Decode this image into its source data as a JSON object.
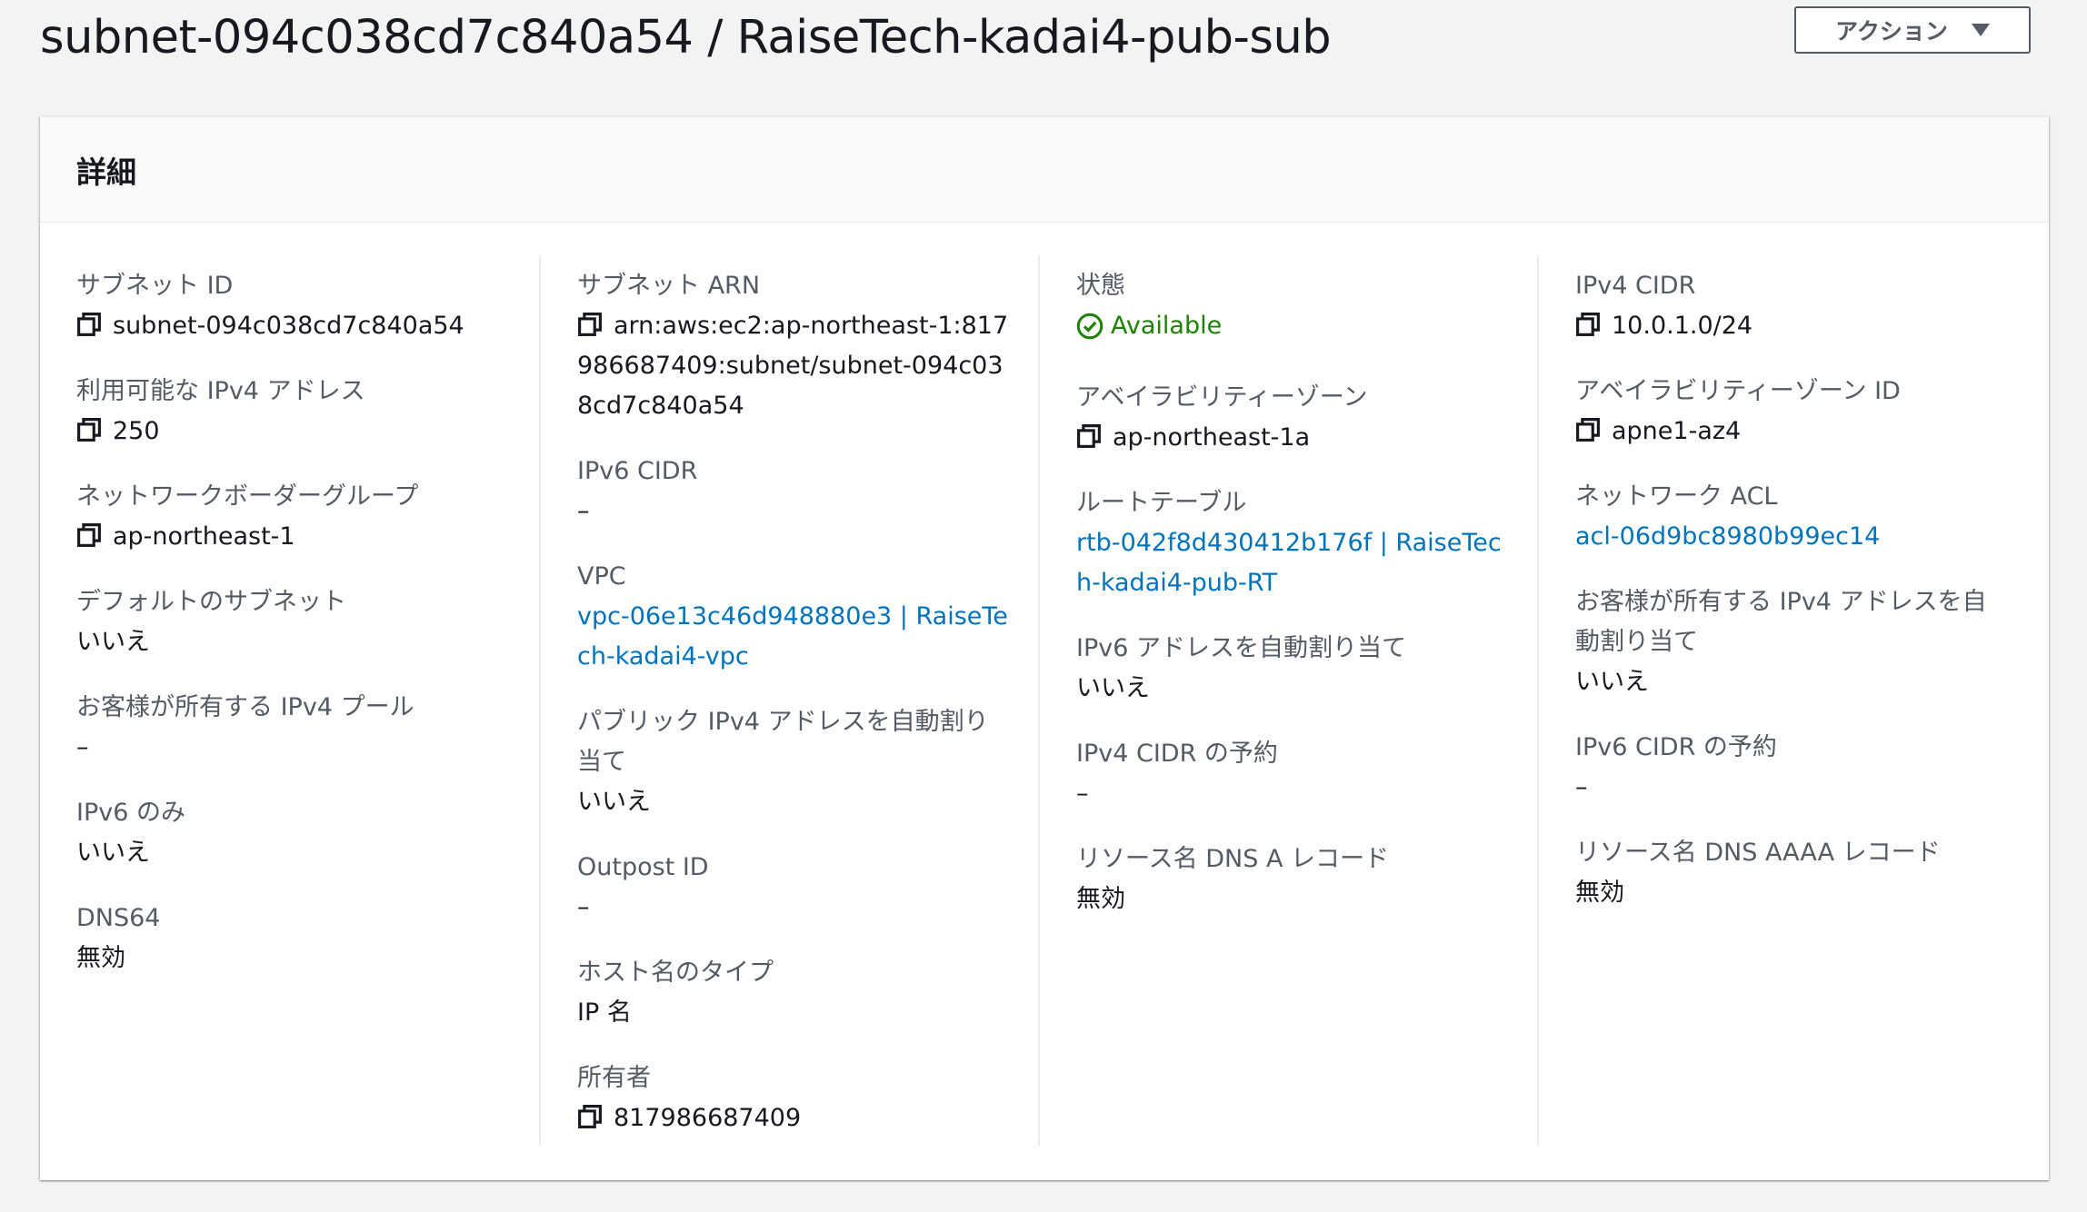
{
  "header": {
    "title": "subnet-094c038cd7c840a54 / RaiseTech-kadai4-pub-sub",
    "actions_label": "アクション"
  },
  "panel": {
    "title": "詳細"
  },
  "columns": [
    [
      {
        "label": "サブネット ID",
        "value": "subnet-094c038cd7c840a54",
        "copy": true
      },
      {
        "label": "利用可能な IPv4 アドレス",
        "value": "250",
        "copy": true
      },
      {
        "label": "ネットワークボーダーグループ",
        "value": "ap-northeast-1",
        "copy": true
      },
      {
        "label": "デフォルトのサブネット",
        "value": "いいえ"
      },
      {
        "label": "お客様が所有する IPv4 プール",
        "value": "–"
      },
      {
        "label": "IPv6 のみ",
        "value": "いいえ"
      },
      {
        "label": "DNS64",
        "value": "無効"
      }
    ],
    [
      {
        "label": "サブネット ARN",
        "value": "arn:aws:ec2:ap-northeast-1:817986687409:subnet/subnet-094c038cd7c840a54",
        "copy": true
      },
      {
        "label": "IPv6 CIDR",
        "value": "–"
      },
      {
        "label": "VPC",
        "value": "vpc-06e13c46d948880e3 | RaiseTech-kadai4-vpc",
        "link": true
      },
      {
        "label": "パブリック IPv4 アドレスを自動割り当て",
        "value": "いいえ"
      },
      {
        "label": "Outpost ID",
        "value": "–"
      },
      {
        "label": "ホスト名のタイプ",
        "value": "IP 名"
      },
      {
        "label": "所有者",
        "value": "817986687409",
        "copy": true
      }
    ],
    [
      {
        "label": "状態",
        "value": "Available",
        "status": true
      },
      {
        "label": "アベイラビリティーゾーン",
        "value": "ap-northeast-1a",
        "copy": true
      },
      {
        "label": "ルートテーブル",
        "value": "rtb-042f8d430412b176f | RaiseTech-kadai4-pub-RT",
        "link": true
      },
      {
        "label": "IPv6 アドレスを自動割り当て",
        "value": "いいえ"
      },
      {
        "label": "IPv4 CIDR の予約",
        "value": "–"
      },
      {
        "label": "リソース名 DNS A レコード",
        "value": "無効"
      }
    ],
    [
      {
        "label": "IPv4 CIDR",
        "value": "10.0.1.0/24",
        "copy": true
      },
      {
        "label": "アベイラビリティーゾーン ID",
        "value": "apne1-az4",
        "copy": true
      },
      {
        "label": "ネットワーク ACL",
        "value": "acl-06d9bc8980b99ec14",
        "link": true
      },
      {
        "label": "お客様が所有する IPv4 アドレスを自動割り当て",
        "value": "いいえ"
      },
      {
        "label": "IPv6 CIDR の予約",
        "value": "–"
      },
      {
        "label": "リソース名 DNS AAAA レコード",
        "value": "無効"
      }
    ]
  ],
  "colors": {
    "link": "#0073bb",
    "status_ok": "#1d8102",
    "label": "#545b64",
    "text": "#16191f",
    "background": "#f2f3f3"
  },
  "icons": {
    "copy": "copy-icon",
    "status": "status-available-icon",
    "dropdown": "caret-down-icon"
  }
}
